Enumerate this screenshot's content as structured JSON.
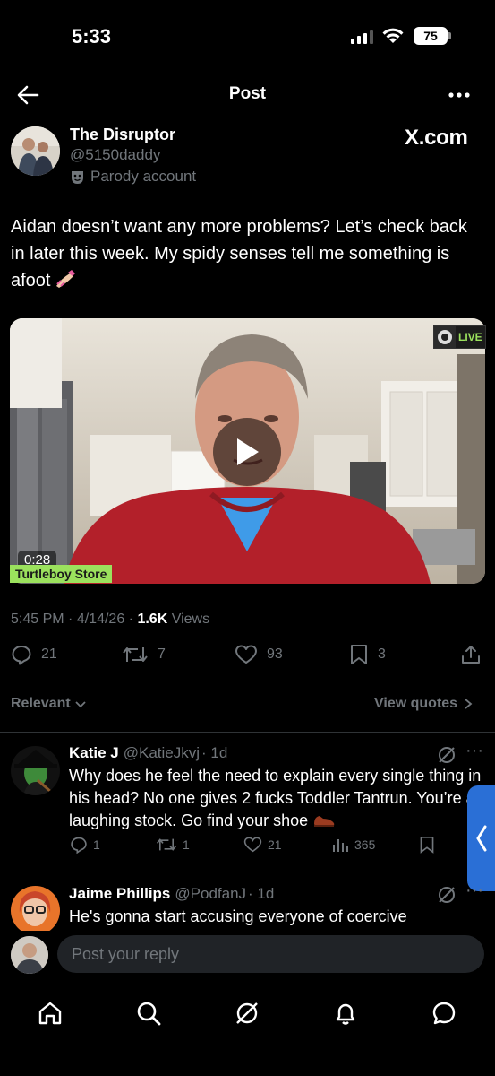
{
  "status_bar": {
    "time": "5:33",
    "battery": "75"
  },
  "header": {
    "title": "Post"
  },
  "post": {
    "author_name": "The Disruptor",
    "author_handle": "@5150daddy",
    "parody_label": "Parody account",
    "source_watermark": "X.com",
    "text": "Aidan doesn’t want any more problems? Let’s check back in later this week. My spidy senses tell me something is afoot",
    "video": {
      "duration": "0:28",
      "store_label": "Turtleboy Store",
      "live_label": "LIVE"
    },
    "meta": {
      "time": "5:45 PM",
      "date": "4/14/26",
      "views_count": "1.6K",
      "views_label": "Views"
    },
    "actions": {
      "replies": "21",
      "reposts": "7",
      "likes": "93",
      "bookmarks": "3"
    }
  },
  "sort": {
    "relevant_label": "Relevant",
    "view_quotes_label": "View quotes"
  },
  "replies": [
    {
      "name": "Katie J",
      "handle": "@KatieJkvj",
      "age": "· 1d",
      "text": "Why does he feel the need to explain every single thing in his head? No one gives 2 fucks Toddler Tantrun. You’re a laughing stock. Go find your shoe",
      "replies": "1",
      "reposts": "1",
      "likes": "21",
      "views": "365"
    },
    {
      "name": "Jaime Phillips",
      "handle": "@PodfanJ",
      "age": "· 1d",
      "text": "He's gonna start accusing everyone of coercive"
    }
  ],
  "composer": {
    "placeholder": "Post your reply"
  },
  "colors": {
    "background": "#000000",
    "muted": "#71767b",
    "accent": "#1d9bf0",
    "store_green": "#9be15d"
  },
  "icons": [
    "back-arrow-icon",
    "more-icon",
    "parody-mask-icon",
    "play-icon",
    "reply-icon",
    "repost-icon",
    "like-icon",
    "bookmark-icon",
    "share-icon",
    "chevron-down-icon",
    "chevron-right-icon",
    "grok-icon",
    "views-icon",
    "home-icon",
    "search-icon",
    "notifications-icon",
    "messages-icon"
  ]
}
